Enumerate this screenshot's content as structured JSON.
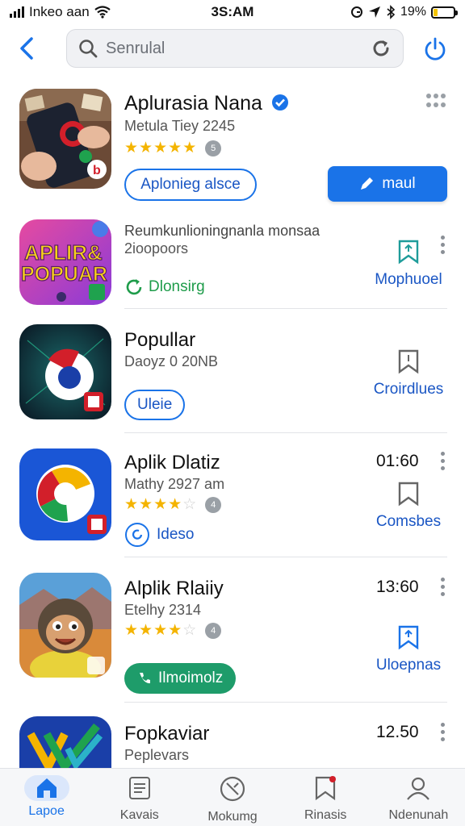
{
  "status_bar": {
    "carrier": "Inkeo aan",
    "time": "3S:AM",
    "battery": "19%",
    "battery_level": 0.19
  },
  "search": {
    "placeholder": "Senrulal"
  },
  "featured": {
    "title": "Aplurasia Nana",
    "subtitle": "Metula Tiey 2245",
    "rating": 5,
    "rating_count": "5",
    "outline_button": "Aplonieg alsce",
    "install_button": "maul"
  },
  "apps": [
    {
      "icon_text": "APLIR & POPUAR",
      "title": "Reumkunlioningnanla monsaa",
      "subtitle": "2ioopoors",
      "tag": "Dlonsirg",
      "action_label": "Mophuoel"
    },
    {
      "title": "Popullar",
      "subtitle": "Daoyz 0 20NB",
      "pill": "Uleie",
      "action_label": "Croirdlues"
    },
    {
      "title": "Aplik Dlatiz",
      "subtitle": "Mathy 2927 am",
      "rating": 4.5,
      "rating_count": "4",
      "pill": "Ideso",
      "time": "01:60",
      "action_label": "Comsbes"
    },
    {
      "title": "Alplik Rlaiiy",
      "subtitle": "Etelhy 2314",
      "rating": 4,
      "rating_count": "4",
      "pill": "Ilmoimolz",
      "time": "13:60",
      "action_label": "Uloepnas"
    },
    {
      "title": "Fopkaviar",
      "subtitle": "Peplevars",
      "time": "12.50"
    }
  ],
  "bottom_nav": [
    {
      "label": "Lapoe",
      "icon": "home-icon",
      "active": true
    },
    {
      "label": "Kavais",
      "icon": "list-icon",
      "active": false
    },
    {
      "label": "Mokumg",
      "icon": "compass-icon",
      "active": false
    },
    {
      "label": "Rinasis",
      "icon": "bookmark-icon",
      "active": false
    },
    {
      "label": "Ndenunah",
      "icon": "person-icon",
      "active": false
    }
  ],
  "colors": {
    "accent": "#1a73e8",
    "green": "#1e9c6a",
    "star": "#f4b400"
  }
}
